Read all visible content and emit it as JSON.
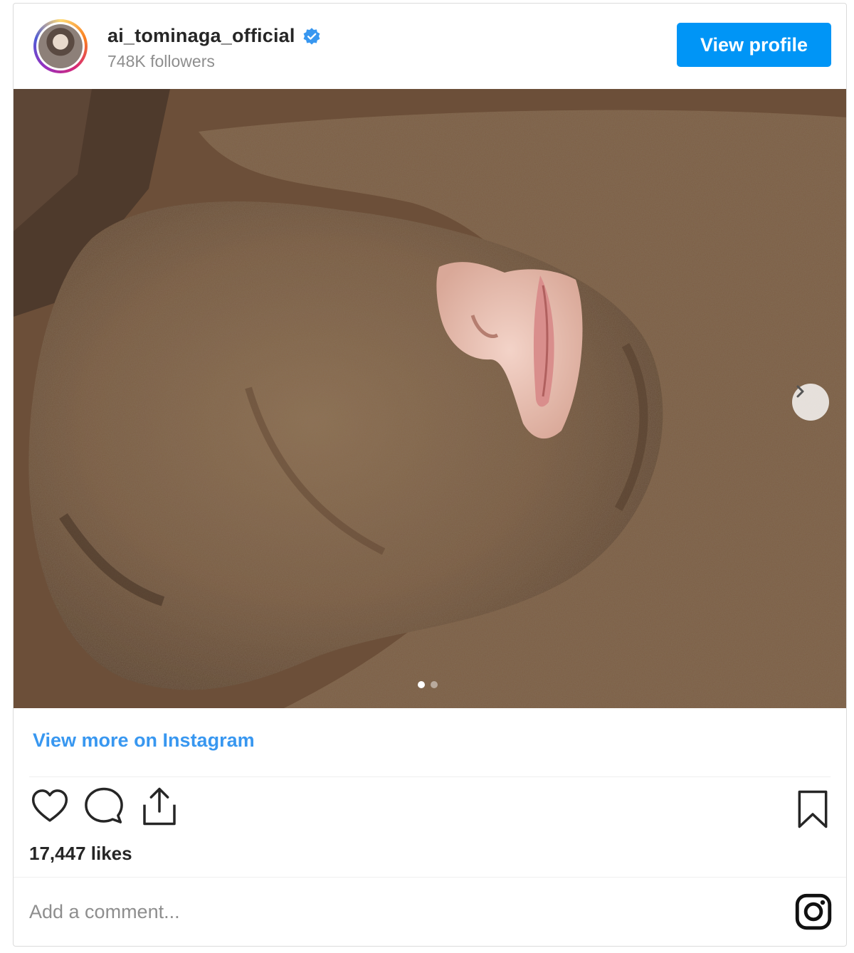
{
  "header": {
    "username": "ai_tominaga_official",
    "verified": true,
    "followers": "748K followers",
    "view_profile_label": "View profile"
  },
  "post": {
    "image": {
      "description_icon": "image",
      "carousel_total": 2,
      "carousel_current": 1
    },
    "view_more_label": "View more on Instagram",
    "likes": "17,447 likes",
    "comment_placeholder": "Add a comment..."
  },
  "colors": {
    "accent": "#0095f6",
    "link": "#3897f0",
    "verified_badge": "#3897f0",
    "muted_text": "#8e8e8e",
    "sand": "#7a5c42"
  },
  "icons": {
    "like": "heart-icon",
    "comment": "comment-icon",
    "share": "share-icon",
    "save": "bookmark-icon",
    "brand": "instagram-icon",
    "next": "chevron-right-icon",
    "verified": "verified-badge-icon"
  }
}
